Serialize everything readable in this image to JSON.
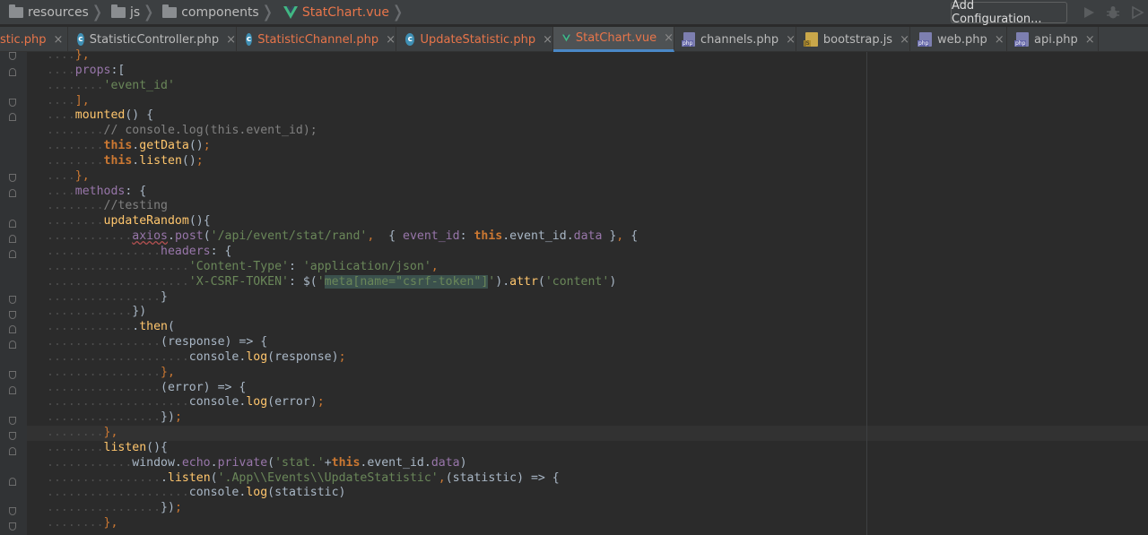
{
  "breadcrumbs": [
    {
      "label": "resources",
      "icon": "folder-icon"
    },
    {
      "label": "js",
      "icon": "folder-icon"
    },
    {
      "label": "components",
      "icon": "folder-icon"
    },
    {
      "label": "StatChart.vue",
      "icon": "vue-icon"
    }
  ],
  "toolbar": {
    "add_configuration": "Add Configuration..."
  },
  "tabs": [
    {
      "label": "stic.php",
      "icon": "none",
      "active": false
    },
    {
      "label": "StatisticController.php",
      "icon": "class-icon",
      "active": false
    },
    {
      "label": "StatisticChannel.php",
      "icon": "class-icon",
      "active": false
    },
    {
      "label": "UpdateStatistic.php",
      "icon": "class-icon",
      "active": false
    },
    {
      "label": "StatChart.vue",
      "icon": "vue-icon",
      "active": true
    },
    {
      "label": "channels.php",
      "icon": "php-file-icon",
      "active": false
    },
    {
      "label": "bootstrap.js",
      "icon": "js-file-icon",
      "active": false
    },
    {
      "label": "web.php",
      "icon": "php-file-icon",
      "active": false
    },
    {
      "label": "api.php",
      "icon": "php-file-icon",
      "active": false
    }
  ],
  "close_glyph": "×",
  "colors": {
    "accent": "#4a88c7",
    "vue_active": "#e8754a",
    "background": "#2b2b2b",
    "keyword": "#cc7832",
    "string": "#6a8759",
    "property": "#9876aa",
    "function": "#ffc66d",
    "comment": "#808080"
  },
  "code_lines": [
    [
      {
        "t": "    ",
        "c": "ind"
      },
      {
        "t": "},",
        "c": "punc"
      }
    ],
    [
      {
        "t": "    ",
        "c": "ind"
      },
      {
        "t": "props",
        "c": "prop"
      },
      {
        "t": ":[",
        "c": "id"
      }
    ],
    [
      {
        "t": "        ",
        "c": "ind"
      },
      {
        "t": "'event_id'",
        "c": "str"
      }
    ],
    [
      {
        "t": "    ",
        "c": "ind"
      },
      {
        "t": "],",
        "c": "punc"
      }
    ],
    [
      {
        "t": "    ",
        "c": "ind"
      },
      {
        "t": "mounted",
        "c": "fn"
      },
      {
        "t": "() {",
        "c": "id"
      }
    ],
    [
      {
        "t": "        ",
        "c": "ind"
      },
      {
        "t": "// console.log(this.event_id);",
        "c": "cm"
      }
    ],
    [
      {
        "t": "        ",
        "c": "ind"
      },
      {
        "t": "this",
        "c": "kw"
      },
      {
        "t": ".",
        "c": "id"
      },
      {
        "t": "getData",
        "c": "fn"
      },
      {
        "t": "()",
        "c": "id"
      },
      {
        "t": ";",
        "c": "punc"
      }
    ],
    [
      {
        "t": "        ",
        "c": "ind"
      },
      {
        "t": "this",
        "c": "kw"
      },
      {
        "t": ".",
        "c": "id"
      },
      {
        "t": "listen",
        "c": "fn"
      },
      {
        "t": "()",
        "c": "id"
      },
      {
        "t": ";",
        "c": "punc"
      }
    ],
    [
      {
        "t": "    ",
        "c": "ind"
      },
      {
        "t": "},",
        "c": "punc"
      }
    ],
    [
      {
        "t": "    ",
        "c": "ind"
      },
      {
        "t": "methods",
        "c": "prop"
      },
      {
        "t": ": {",
        "c": "id"
      }
    ],
    [
      {
        "t": "        ",
        "c": "ind"
      },
      {
        "t": "//testing",
        "c": "cm"
      }
    ],
    [
      {
        "t": "        ",
        "c": "ind"
      },
      {
        "t": "updateRandom",
        "c": "fn"
      },
      {
        "t": "(){",
        "c": "id"
      }
    ],
    [
      {
        "t": "            ",
        "c": "ind"
      },
      {
        "t": "axios",
        "c": "prop undl"
      },
      {
        "t": ".",
        "c": "id"
      },
      {
        "t": "post",
        "c": "prop"
      },
      {
        "t": "(",
        "c": "id"
      },
      {
        "t": "'/api/event/stat/rand'",
        "c": "str"
      },
      {
        "t": ",  ",
        "c": "punc"
      },
      {
        "t": "{ ",
        "c": "id"
      },
      {
        "t": "event_id",
        "c": "prop"
      },
      {
        "t": ": ",
        "c": "id"
      },
      {
        "t": "this",
        "c": "kw"
      },
      {
        "t": ".event_id.",
        "c": "id"
      },
      {
        "t": "data",
        "c": "prop"
      },
      {
        "t": " }",
        "c": "id"
      },
      {
        "t": ",",
        "c": "punc"
      },
      {
        "t": " {",
        "c": "id"
      }
    ],
    [
      {
        "t": "                ",
        "c": "ind"
      },
      {
        "t": "headers",
        "c": "prop"
      },
      {
        "t": ": {",
        "c": "id"
      }
    ],
    [
      {
        "t": "                    ",
        "c": "ind"
      },
      {
        "t": "'Content-Type'",
        "c": "str"
      },
      {
        "t": ": ",
        "c": "id"
      },
      {
        "t": "'application/json'",
        "c": "str"
      },
      {
        "t": ",",
        "c": "punc"
      }
    ],
    [
      {
        "t": "                    ",
        "c": "ind"
      },
      {
        "t": "'X-CSRF-TOKEN'",
        "c": "str"
      },
      {
        "t": ": $(",
        "c": "id"
      },
      {
        "t": "'",
        "c": "str"
      },
      {
        "t": "meta[name=\"csrf-token\"]",
        "c": "str sel"
      },
      {
        "t": "'",
        "c": "str"
      },
      {
        "t": ").",
        "c": "id"
      },
      {
        "t": "attr",
        "c": "fn"
      },
      {
        "t": "(",
        "c": "id"
      },
      {
        "t": "'content'",
        "c": "str"
      },
      {
        "t": ")",
        "c": "id"
      }
    ],
    [
      {
        "t": "                ",
        "c": "ind"
      },
      {
        "t": "}",
        "c": "id"
      }
    ],
    [
      {
        "t": "            ",
        "c": "ind"
      },
      {
        "t": "})",
        "c": "id"
      }
    ],
    [
      {
        "t": "            ",
        "c": "ind"
      },
      {
        "t": ".",
        "c": "id"
      },
      {
        "t": "then",
        "c": "fn"
      },
      {
        "t": "(",
        "c": "id"
      }
    ],
    [
      {
        "t": "                ",
        "c": "ind"
      },
      {
        "t": "(response) => {",
        "c": "id"
      }
    ],
    [
      {
        "t": "                    ",
        "c": "ind"
      },
      {
        "t": "console.",
        "c": "id"
      },
      {
        "t": "log",
        "c": "fn"
      },
      {
        "t": "(response)",
        "c": "id"
      },
      {
        "t": ";",
        "c": "punc"
      }
    ],
    [
      {
        "t": "                ",
        "c": "ind"
      },
      {
        "t": "},",
        "c": "punc"
      }
    ],
    [
      {
        "t": "                ",
        "c": "ind"
      },
      {
        "t": "(error) => {",
        "c": "id"
      }
    ],
    [
      {
        "t": "                    ",
        "c": "ind"
      },
      {
        "t": "console.",
        "c": "id"
      },
      {
        "t": "log",
        "c": "fn"
      },
      {
        "t": "(error)",
        "c": "id"
      },
      {
        "t": ";",
        "c": "punc"
      }
    ],
    [
      {
        "t": "                ",
        "c": "ind"
      },
      {
        "t": "})",
        "c": "id"
      },
      {
        "t": ";",
        "c": "punc"
      }
    ],
    [
      {
        "t": "        ",
        "c": "ind"
      },
      {
        "t": "},",
        "c": "punc"
      }
    ],
    [
      {
        "t": "        ",
        "c": "ind"
      },
      {
        "t": "listen",
        "c": "fn"
      },
      {
        "t": "(){",
        "c": "id"
      }
    ],
    [
      {
        "t": "            ",
        "c": "ind"
      },
      {
        "t": "window.",
        "c": "id"
      },
      {
        "t": "echo",
        "c": "prop"
      },
      {
        "t": ".",
        "c": "id"
      },
      {
        "t": "private",
        "c": "prop"
      },
      {
        "t": "(",
        "c": "id"
      },
      {
        "t": "'stat.'",
        "c": "str"
      },
      {
        "t": "+",
        "c": "id"
      },
      {
        "t": "this",
        "c": "kw"
      },
      {
        "t": ".event_id.",
        "c": "id"
      },
      {
        "t": "data",
        "c": "prop"
      },
      {
        "t": ")",
        "c": "id"
      }
    ],
    [
      {
        "t": "                ",
        "c": "ind"
      },
      {
        "t": ".",
        "c": "id"
      },
      {
        "t": "listen",
        "c": "fn"
      },
      {
        "t": "(",
        "c": "id"
      },
      {
        "t": "'.App\\\\Events\\\\UpdateStatistic'",
        "c": "str"
      },
      {
        "t": ",",
        "c": "punc"
      },
      {
        "t": "(statistic) => {",
        "c": "id"
      }
    ],
    [
      {
        "t": "                    ",
        "c": "ind"
      },
      {
        "t": "console.",
        "c": "id"
      },
      {
        "t": "log",
        "c": "fn"
      },
      {
        "t": "(statistic)",
        "c": "id"
      }
    ],
    [
      {
        "t": "                ",
        "c": "ind"
      },
      {
        "t": "})",
        "c": "id"
      },
      {
        "t": ";",
        "c": "punc"
      }
    ],
    [
      {
        "t": "        ",
        "c": "ind"
      },
      {
        "t": "},",
        "c": "punc"
      }
    ]
  ]
}
